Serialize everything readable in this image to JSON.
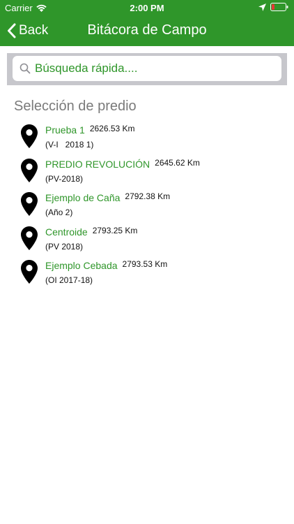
{
  "status_bar": {
    "carrier": "Carrier",
    "time": "2:00 PM"
  },
  "nav": {
    "back_label": "Back",
    "title": "Bitácora de Campo"
  },
  "search": {
    "placeholder": "Búsqueda rápida...."
  },
  "section_title": "Selección de predio",
  "predios": [
    {
      "name": "Prueba 1",
      "distance": "2626.53 Km",
      "cycle": "(V-I   2018 1)"
    },
    {
      "name": "PREDIO REVOLUCIÓN",
      "distance": "2645.62 Km",
      "cycle": "(PV-2018)"
    },
    {
      "name": "Ejemplo de Caña",
      "distance": "2792.38 Km",
      "cycle": "(Año 2)"
    },
    {
      "name": "Centroide",
      "distance": "2793.25 Km",
      "cycle": "(PV 2018)"
    },
    {
      "name": "Ejemplo Cebada",
      "distance": "2793.53 Km",
      "cycle": "(OI 2017-18)"
    }
  ],
  "colors": {
    "brand_green": "#2f962a",
    "search_bg": "#c7c7cc",
    "battery_low": "#e53935"
  },
  "icons": {
    "wifi": "wifi-icon",
    "location": "location-arrow-icon",
    "battery": "battery-icon",
    "back": "chevron-left-icon",
    "search": "search-icon",
    "pin": "map-pin-icon"
  }
}
